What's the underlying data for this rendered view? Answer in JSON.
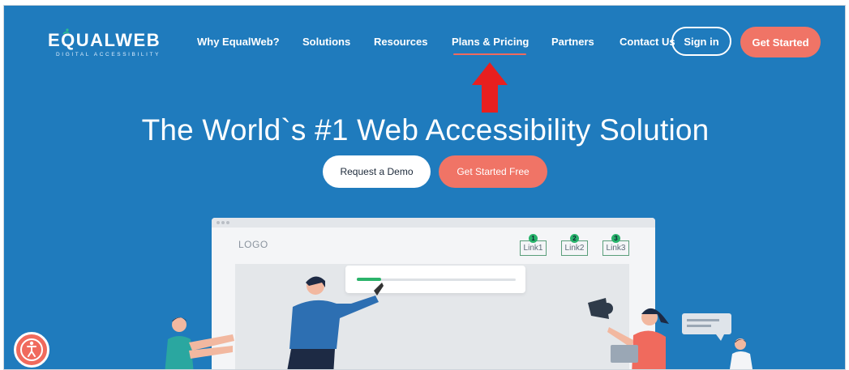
{
  "brand": {
    "name": "EQUALWEB",
    "tagline": "DIGITAL ACCESSIBILITY"
  },
  "nav": {
    "items": [
      {
        "label": "Why EqualWeb?"
      },
      {
        "label": "Solutions"
      },
      {
        "label": "Resources"
      },
      {
        "label": "Plans & Pricing",
        "active": true
      },
      {
        "label": "Partners"
      },
      {
        "label": "Contact Us"
      }
    ],
    "sign_in": "Sign in",
    "get_started": "Get Started"
  },
  "hero": {
    "title": "The World`s #1 Web Accessibility Solution",
    "demo_button": "Request a Demo",
    "free_button": "Get Started Free"
  },
  "mockup": {
    "logo": "LOGO",
    "links": [
      {
        "badge": "1",
        "label": "Link1"
      },
      {
        "badge": "2",
        "label": "Link2"
      },
      {
        "badge": "3",
        "label": "Link3"
      }
    ]
  },
  "colors": {
    "background": "#1f7bbd",
    "accent": "#f07466",
    "arrow": "#e81f1f",
    "badge": "#28b36b"
  },
  "icons": {
    "accessibility_widget": "accessibility-icon",
    "annotation_arrow": "arrow-up-icon"
  }
}
